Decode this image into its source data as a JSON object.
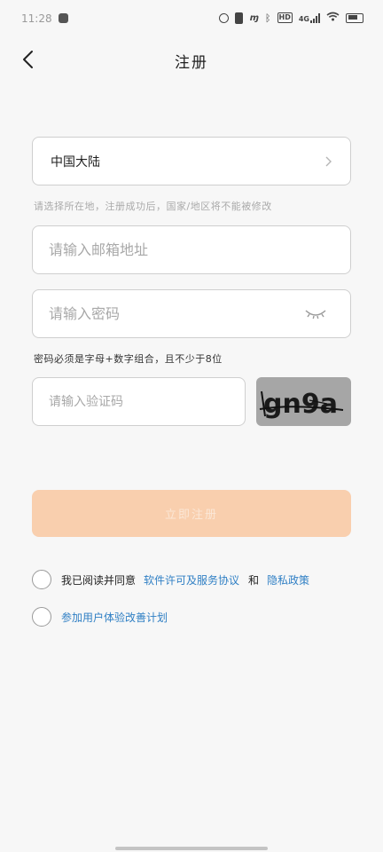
{
  "status_bar": {
    "time": "11:28",
    "network": "4G"
  },
  "header": {
    "title": "注册"
  },
  "form": {
    "region_value": "中国大陆",
    "region_hint": "请选择所在地，注册成功后，国家/地区将不能被修改",
    "email_placeholder": "请输入邮箱地址",
    "password_placeholder": "请输入密码",
    "password_hint": "密码必须是字母+数字组合，且不少于8位",
    "captcha_placeholder": "请输入验证码",
    "captcha_text": "gn9a",
    "submit_label": "立即注册"
  },
  "agreements": {
    "read_prefix": "我已阅读并同意",
    "license_link": "软件许可及服务协议",
    "and": "和",
    "privacy_link": "隐私政策",
    "ux_plan": "参加用户体验改善计划"
  },
  "colors": {
    "accent_disabled": "#f9cfae",
    "link": "#2f7fc4",
    "background": "#f7f7f7"
  }
}
